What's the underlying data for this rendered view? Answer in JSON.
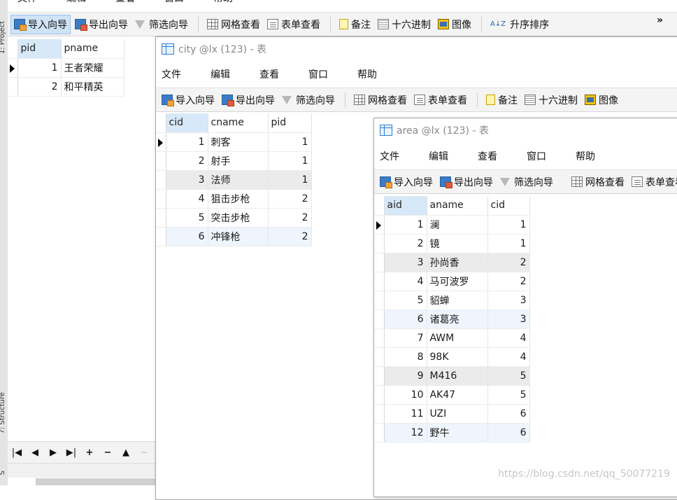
{
  "ide": {
    "tab_project": "1: Project",
    "tab_structure": "7: Structure",
    "tab_bottom": "S"
  },
  "menus": [
    "文件",
    "编辑",
    "查看",
    "窗口",
    "帮助"
  ],
  "toolbar": {
    "import": "导入向导",
    "export": "导出向导",
    "filter": "筛选向导",
    "grid_view": "网格查看",
    "form_view": "表单查看",
    "memo": "备注",
    "hex": "十六进制",
    "image": "图像",
    "sort_asc": "升序排序",
    "sort_icon_text": "A↓Z",
    "more": "»"
  },
  "windows": {
    "province": {
      "columns": [
        "pid",
        "pname"
      ],
      "rows": [
        {
          "pid": "1",
          "pname": "王者荣耀"
        },
        {
          "pid": "2",
          "pname": "和平精英"
        }
      ],
      "nav": [
        "|◀",
        "◀",
        "▶",
        "▶|",
        "+",
        "−",
        "▲",
        "~"
      ]
    },
    "city": {
      "title": "city @lx (123) - 表",
      "columns": [
        "cid",
        "cname",
        "pid"
      ],
      "rows": [
        {
          "cid": "1",
          "cname": "刺客",
          "pid": "1"
        },
        {
          "cid": "2",
          "cname": "射手",
          "pid": "1"
        },
        {
          "cid": "3",
          "cname": "法师",
          "pid": "1"
        },
        {
          "cid": "4",
          "cname": "狙击步枪",
          "pid": "2"
        },
        {
          "cid": "5",
          "cname": "突击步枪",
          "pid": "2"
        },
        {
          "cid": "6",
          "cname": "冲锋枪",
          "pid": "2"
        }
      ]
    },
    "area": {
      "title": "area @lx (123) - 表",
      "columns": [
        "aid",
        "aname",
        "cid"
      ],
      "rows": [
        {
          "aid": "1",
          "aname": "澜",
          "cid": "1"
        },
        {
          "aid": "2",
          "aname": "镜",
          "cid": "1"
        },
        {
          "aid": "3",
          "aname": "孙尚香",
          "cid": "2"
        },
        {
          "aid": "4",
          "aname": "马可波罗",
          "cid": "2"
        },
        {
          "aid": "5",
          "aname": "貂蝉",
          "cid": "3"
        },
        {
          "aid": "6",
          "aname": "诸葛亮",
          "cid": "3"
        },
        {
          "aid": "7",
          "aname": "AWM",
          "cid": "4"
        },
        {
          "aid": "8",
          "aname": "98K",
          "cid": "4"
        },
        {
          "aid": "9",
          "aname": "M416",
          "cid": "5"
        },
        {
          "aid": "10",
          "aname": "AK47",
          "cid": "5"
        },
        {
          "aid": "11",
          "aname": "UZI",
          "cid": "6"
        },
        {
          "aid": "12",
          "aname": "野牛",
          "cid": "6"
        }
      ]
    }
  },
  "watermark": "https://blog.csdn.net/qq_50077219"
}
